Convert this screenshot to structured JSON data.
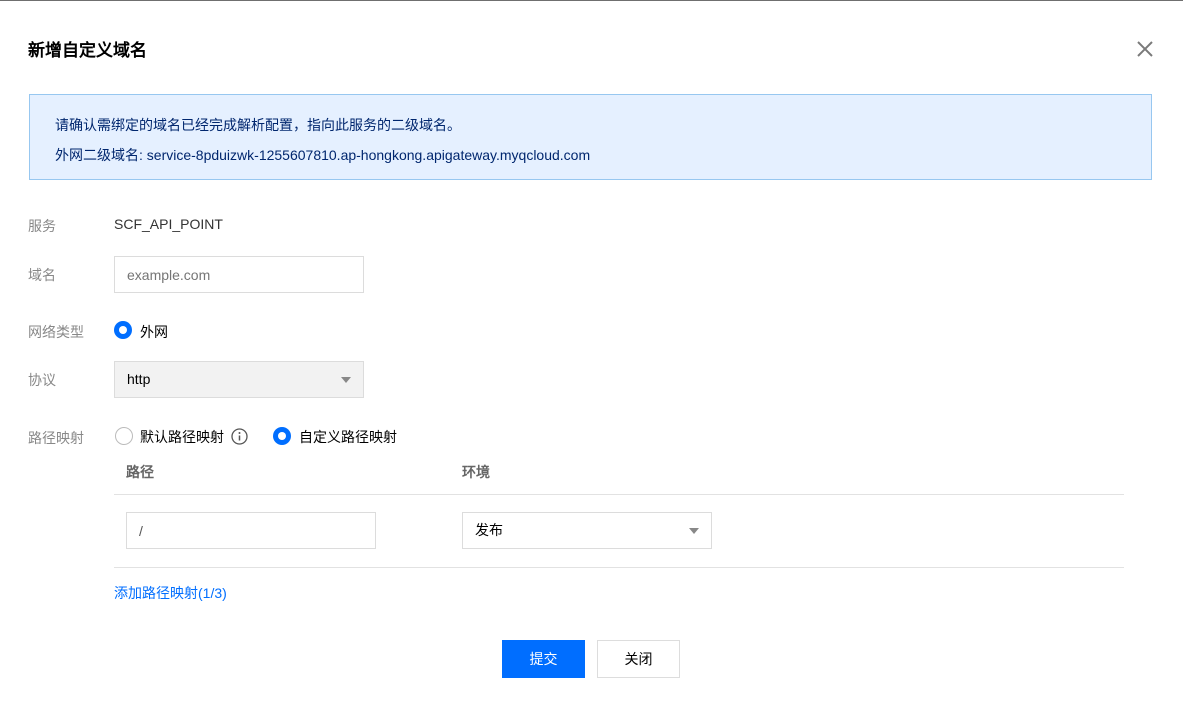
{
  "dialog": {
    "title": "新增自定义域名"
  },
  "notice": {
    "line1": "请确认需绑定的域名已经完成解析配置，指向此服务的二级域名。",
    "line2": "外网二级域名: service-8pduizwk-1255607810.ap-hongkong.apigateway.myqcloud.com"
  },
  "form": {
    "service": {
      "label": "服务",
      "value": "SCF_API_POINT"
    },
    "domain": {
      "label": "域名",
      "placeholder": "example.com"
    },
    "network": {
      "label": "网络类型",
      "option": "外网"
    },
    "protocol": {
      "label": "协议",
      "value": "http"
    },
    "path_mapping": {
      "label": "路径映射",
      "option_default": "默认路径映射",
      "option_custom": "自定义路径映射",
      "col_path": "路径",
      "col_env": "环境",
      "rows": [
        {
          "path": "/",
          "env": "发布"
        }
      ],
      "add_link": "添加路径映射(1/3)"
    }
  },
  "footer": {
    "submit": "提交",
    "close": "关闭"
  },
  "colors": {
    "accent": "#006eff",
    "notice_bg": "#e5f0ff",
    "notice_border": "#97c7f0"
  }
}
